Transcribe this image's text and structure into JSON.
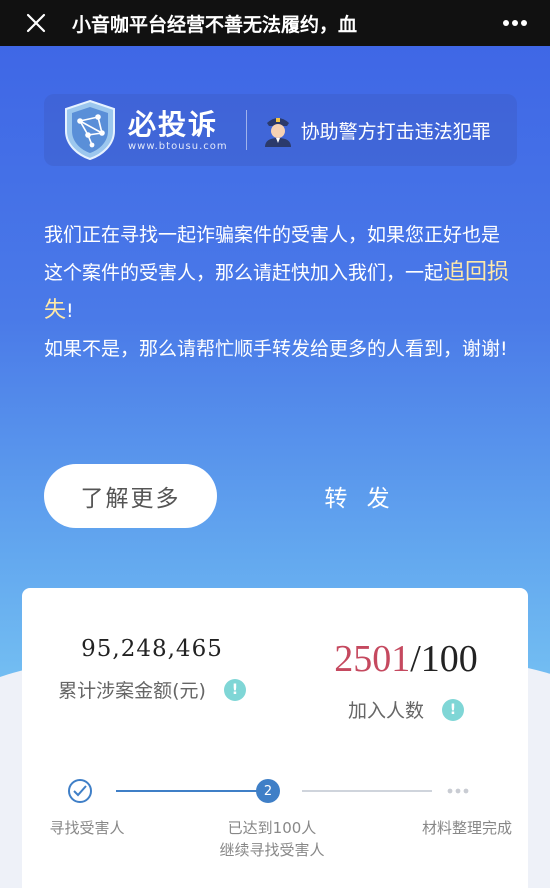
{
  "topbar": {
    "title": "小音咖平台经营不善无法履约，血",
    "close_icon": "close-icon",
    "more_icon": "more-icon"
  },
  "brand": {
    "name": "必投诉",
    "url": "www.btousu.com",
    "slogan": "协助警方打击违法犯罪"
  },
  "intro": {
    "line1": "我们正在寻找一起诈骗案件的受害人，如果您正好也是这个案件的受害人，那么请赶快加入我们，一起",
    "highlight": "追回损失",
    "line1_end": "!",
    "line2": "如果不是，那么请帮忙顺手转发给更多的人看到，谢谢!"
  },
  "buttons": {
    "learn_more": "了解更多",
    "share": "转 发"
  },
  "stats": {
    "amount_value": "95,248,465",
    "amount_label": "累计涉案金额(元)",
    "join_current": "2501",
    "join_total": "/100",
    "join_label": "加入人数",
    "info_mark": "!"
  },
  "steps": [
    {
      "label": "寻找受害人",
      "state": "done"
    },
    {
      "number": "2",
      "label": "已达到100人",
      "sublabel": "继续寻找受害人",
      "state": "current"
    },
    {
      "label": "材料整理完成",
      "state": "pending"
    }
  ],
  "colors": {
    "accent": "#3f7fc7",
    "highlight": "#ffe9a8",
    "join_number": "#c5495f",
    "info": "#7fd6d6"
  }
}
